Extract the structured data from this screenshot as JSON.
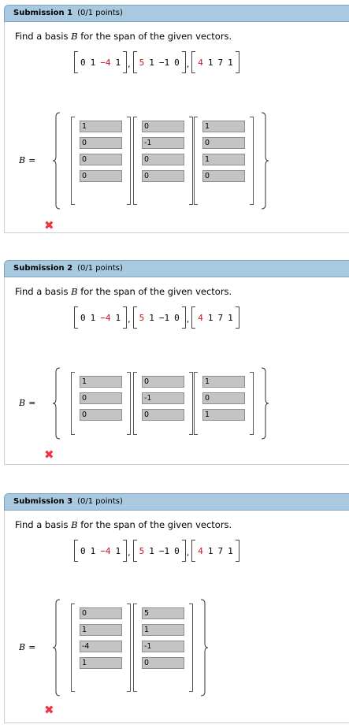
{
  "submissions": [
    {
      "title": "Submission 1",
      "points": "(0/1 points)",
      "prompt_before": "Find a basis",
      "basis_symbol": "B",
      "prompt_after": "for the span of the given vectors.",
      "vectors": [
        [
          "0",
          "1",
          "−4",
          "1"
        ],
        [
          "5",
          "1",
          "−1",
          "0"
        ],
        [
          "4",
          "1",
          "7",
          "1"
        ]
      ],
      "basis_label": "B",
      "equals": "=",
      "answer_columns": [
        [
          "1",
          "0",
          "0",
          "0"
        ],
        [
          "0",
          "-1",
          "0",
          "0"
        ],
        [
          "1",
          "0",
          "1",
          "0"
        ]
      ],
      "result_icon": "x-icon"
    },
    {
      "title": "Submission 2",
      "points": "(0/1 points)",
      "prompt_before": "Find a basis",
      "basis_symbol": "B",
      "prompt_after": "for the span of the given vectors.",
      "vectors": [
        [
          "0",
          "1",
          "−4",
          "1"
        ],
        [
          "5",
          "1",
          "−1",
          "0"
        ],
        [
          "4",
          "1",
          "7",
          "1"
        ]
      ],
      "basis_label": "B",
      "equals": "=",
      "answer_columns": [
        [
          "1",
          "0",
          "0"
        ],
        [
          "0",
          "-1",
          "0"
        ],
        [
          "1",
          "0",
          "1"
        ]
      ],
      "result_icon": "x-icon"
    },
    {
      "title": "Submission 3",
      "points": "(0/1 points)",
      "prompt_before": "Find a basis",
      "basis_symbol": "B",
      "prompt_after": "for the span of the given vectors.",
      "vectors": [
        [
          "0",
          "1",
          "−4",
          "1"
        ],
        [
          "5",
          "1",
          "−1",
          "0"
        ],
        [
          "4",
          "1",
          "7",
          "1"
        ]
      ],
      "basis_label": "B",
      "equals": "=",
      "answer_columns": [
        [
          "0",
          "1",
          "-4",
          "1"
        ],
        [
          "5",
          "1",
          "-1",
          "0"
        ]
      ],
      "result_icon": "x-icon"
    }
  ],
  "colors": {
    "header_bg": "#a9c9e0",
    "highlight": "#cc1122",
    "wrong": "#ee3344",
    "cell_bg": "#c4c4c4"
  }
}
